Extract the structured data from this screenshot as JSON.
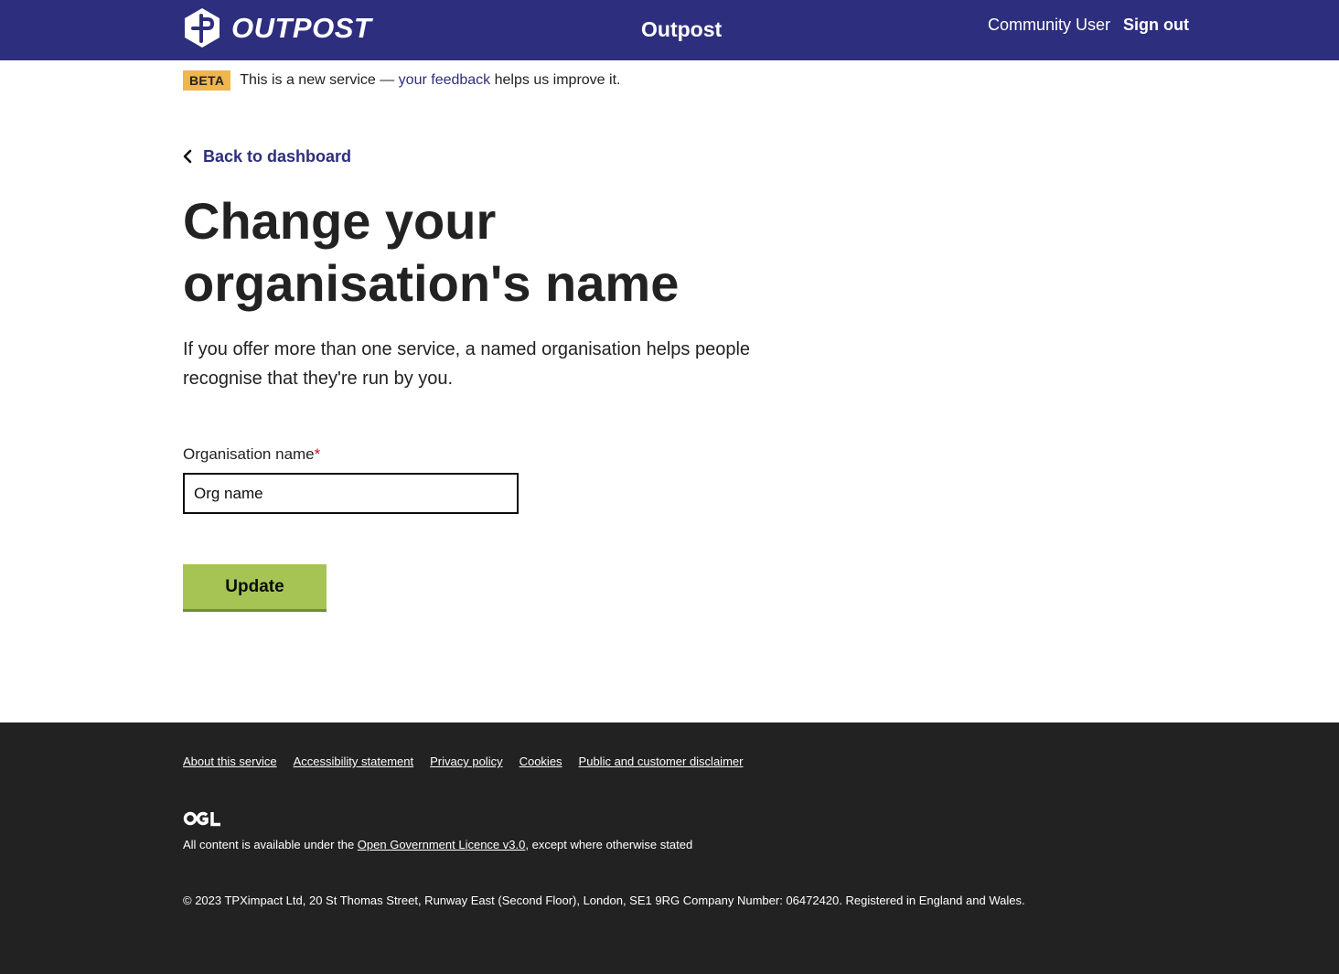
{
  "header": {
    "logo_text": "OUTPOST",
    "logo_icon": "outpost-logo-icon",
    "service_name": "Outpost",
    "user_name": "Community User",
    "sign_out_label": "Sign out"
  },
  "phase_banner": {
    "tag": "BETA",
    "text_before": "This is a new service — ",
    "feedback_link": "your feedback",
    "text_after": " helps us improve it."
  },
  "back_link": {
    "label": "Back to dashboard",
    "icon": "chevron-left-icon"
  },
  "page": {
    "title": "Change your organisation's name",
    "intro": "If you offer more than one service, a named organisation helps people recognise that they're run by you."
  },
  "form": {
    "field_label": "Organisation name",
    "required_marker": "*",
    "field_value": "Org name",
    "submit_label": "Update"
  },
  "footer": {
    "links": [
      "About this service",
      "Accessibility statement",
      "Privacy policy",
      "Cookies",
      "Public and customer disclaimer"
    ],
    "ogl_logo": "OGL",
    "licence_before": "All content is available under the ",
    "licence_link": "Open Government Licence v3.0",
    "licence_after": ", except where otherwise stated",
    "copyright": "© 2023 TPXimpact Ltd, 20 St Thomas Street, Runway East (Second Floor), London, SE1 9RG Company Number: 06472420. Registered in England and Wales."
  },
  "colors": {
    "header_bg": "#2e2e7f",
    "link": "#2e2e7f",
    "beta_tag": "#f0b64c",
    "button": "#a6c454",
    "footer_bg": "#222222",
    "required": "#c0102b"
  }
}
